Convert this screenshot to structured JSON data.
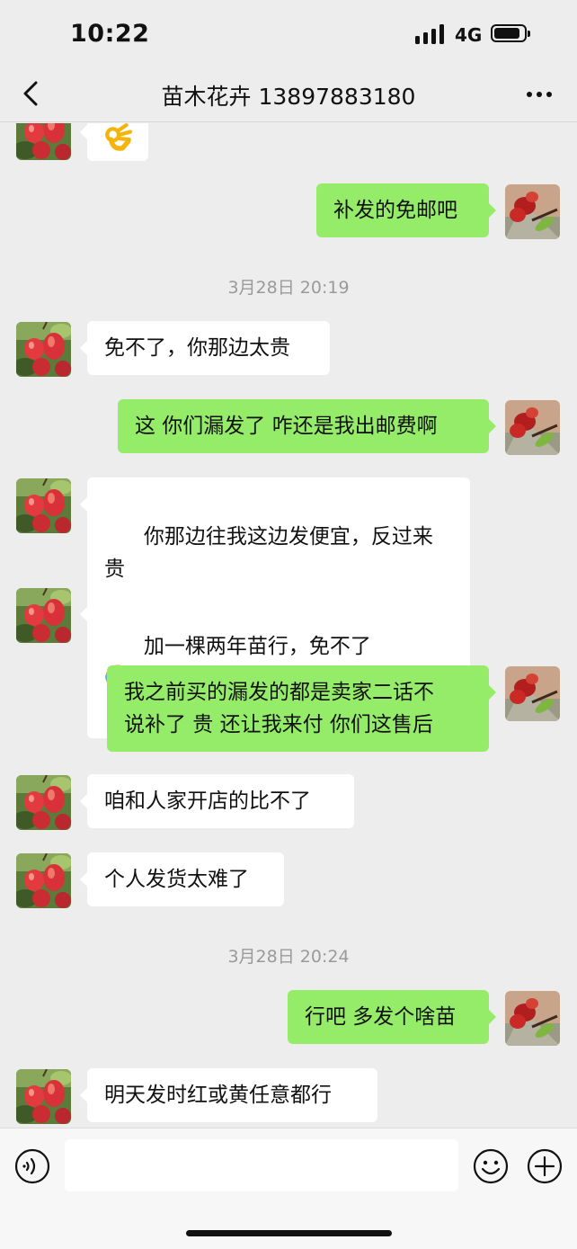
{
  "status_bar": {
    "time": "10:22",
    "network": "4G"
  },
  "nav": {
    "title": "苗木花卉 13897883180"
  },
  "timestamps": [
    "3月28日 20:19",
    "3月28日 20:24"
  ],
  "messages": [
    {
      "side": "right",
      "text": "补发的免邮吧"
    },
    {
      "side": "left",
      "text": "免不了，你那边太贵"
    },
    {
      "side": "right",
      "text": "这 你们漏发了 咋还是我出邮费啊"
    },
    {
      "side": "left",
      "text": "你那边往我这边发便宜，反过来贵",
      "emoji": "tears-of-joy"
    },
    {
      "side": "left",
      "text": "加一棵两年苗行，免不了",
      "emoji": "tears-of-joy"
    },
    {
      "side": "right",
      "text": "我之前买的漏发的都是卖家二话不\n说补了 贵 还让我来付 你们这售后"
    },
    {
      "side": "left",
      "text": "咱和人家开店的比不了"
    },
    {
      "side": "left",
      "text": "个人发货太难了"
    },
    {
      "side": "right",
      "text": "行吧 多发个啥苗"
    },
    {
      "side": "left",
      "text": "明天发时红或黄任意都行"
    }
  ],
  "first_message_emoji": "ok-hand",
  "colors": {
    "outgoing_bubble": "#95ec69",
    "incoming_bubble": "#ffffff",
    "background": "#ededed"
  }
}
